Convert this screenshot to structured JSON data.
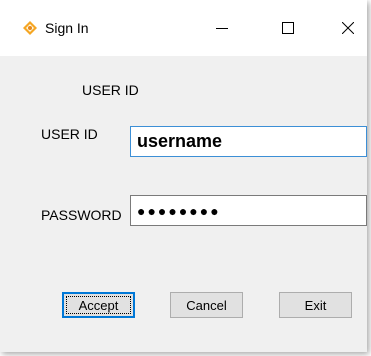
{
  "window": {
    "title": "Sign In",
    "controls": {
      "minimize_icon": "minimize-icon",
      "maximize_icon": "maximize-icon",
      "close_icon": "close-icon"
    },
    "app_icon": "app-icon"
  },
  "form": {
    "header": "USER ID",
    "userid_label": "USER ID",
    "userid_value": "username",
    "password_label": "PASSWORD",
    "password_value": "●●●●●●●●"
  },
  "buttons": {
    "accept": "Accept",
    "cancel": "Cancel",
    "exit": "Exit"
  },
  "colors": {
    "focus_border": "#3c8fd6",
    "default_button_border": "#0078d7",
    "app_icon_orange": "#f5a623"
  }
}
